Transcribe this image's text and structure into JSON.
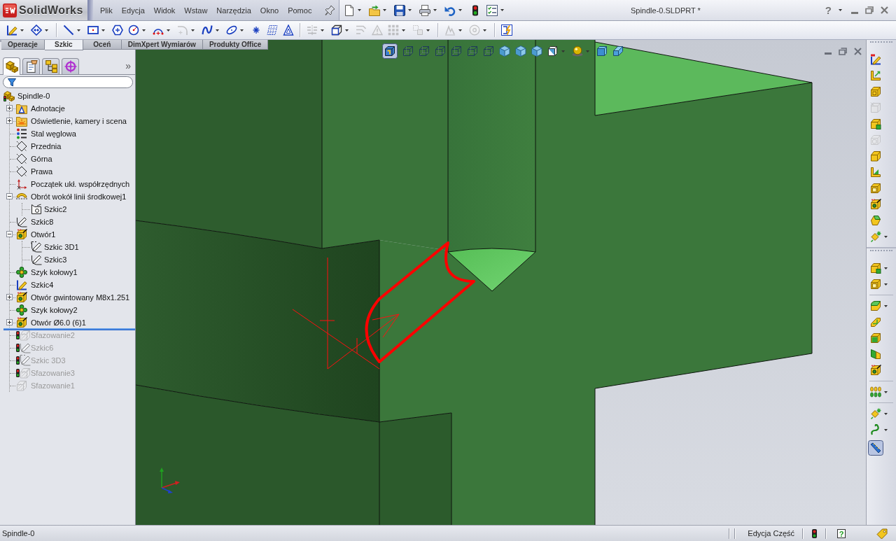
{
  "title_bar": {
    "logo": "SolidWorks",
    "menu": [
      "Plik",
      "Edycja",
      "Widok",
      "Wstaw",
      "Narzędzia",
      "Okno",
      "Pomoc"
    ],
    "quick_access": [
      {
        "kind": "new",
        "dropdown": true
      },
      {
        "kind": "open",
        "dropdown": true
      },
      {
        "kind": "save",
        "dropdown": true
      },
      {
        "kind": "print",
        "dropdown": true
      },
      {
        "kind": "undo",
        "dropdown": true
      },
      {
        "kind": "rebuild",
        "dropdown": false
      },
      {
        "kind": "options",
        "dropdown": true
      }
    ],
    "title": "Spindle-0.SLDPRT *",
    "help": "?"
  },
  "sketch_toolbar": [
    [
      {
        "kind": "sketch-tool",
        "dropdown": true,
        "disabled": false
      },
      {
        "kind": "dimension",
        "dropdown": true,
        "disabled": false
      }
    ],
    [
      {
        "kind": "line",
        "dropdown": true,
        "disabled": false
      },
      {
        "kind": "rectangle",
        "dropdown": true,
        "disabled": false
      },
      {
        "kind": "polygon",
        "dropdown": false,
        "disabled": false
      },
      {
        "kind": "circle",
        "dropdown": true,
        "disabled": false
      },
      {
        "kind": "arc",
        "dropdown": true,
        "disabled": false
      },
      {
        "kind": "sketch-fillet",
        "dropdown": true,
        "disabled": true
      },
      {
        "kind": "spline",
        "dropdown": true,
        "disabled": false
      },
      {
        "kind": "ellipse",
        "dropdown": true,
        "disabled": false
      },
      {
        "kind": "point",
        "dropdown": false,
        "disabled": false
      },
      {
        "kind": "sketch-picture",
        "dropdown": false,
        "disabled": false
      },
      {
        "kind": "text",
        "dropdown": false,
        "disabled": false
      }
    ],
    [
      {
        "kind": "mirror",
        "dropdown": true,
        "disabled": true
      },
      {
        "kind": "convert",
        "dropdown": true,
        "disabled": false
      },
      {
        "kind": "trim",
        "dropdown": false,
        "disabled": true
      },
      {
        "kind": "warning",
        "dropdown": false,
        "disabled": true
      },
      {
        "kind": "grid",
        "dropdown": true,
        "disabled": true
      },
      {
        "kind": "move",
        "dropdown": true,
        "disabled": true
      }
    ],
    [
      {
        "kind": "repair",
        "dropdown": true,
        "disabled": true
      },
      {
        "kind": "snap",
        "dropdown": true,
        "disabled": true
      }
    ],
    [
      {
        "kind": "quick-snap",
        "dropdown": false,
        "disabled": false
      }
    ]
  ],
  "command_tabs": [
    {
      "label": "Operacje",
      "selected": false
    },
    {
      "label": "Szkic",
      "selected": true
    },
    {
      "label": "Oceń",
      "selected": false
    },
    {
      "label": "DimXpert Wymiarów",
      "selected": false
    },
    {
      "label": "Produkty Office",
      "selected": false
    }
  ],
  "panel_tabs": {
    "items": [
      {
        "kind": "features",
        "selected": true
      },
      {
        "kind": "properties",
        "selected": false
      },
      {
        "kind": "configurations",
        "selected": false
      },
      {
        "kind": "dimxpert",
        "selected": false
      }
    ],
    "more": "»"
  },
  "feature_tree": {
    "label": "Spindle-0",
    "kind": "part",
    "children": [
      {
        "label": "Adnotacje",
        "kind": "annotations",
        "expanded": false,
        "rolled_back": false,
        "flagged": false
      },
      {
        "label": "Oświetlenie, kamery i scena",
        "kind": "lights",
        "expanded": false,
        "rolled_back": false,
        "flagged": false
      },
      {
        "label": "Stal węglowa",
        "kind": "material",
        "rolled_back": false,
        "flagged": false
      },
      {
        "label": "Przednia",
        "kind": "plane",
        "rolled_back": false,
        "flagged": false
      },
      {
        "label": "Górna",
        "kind": "plane",
        "rolled_back": false,
        "flagged": false
      },
      {
        "label": "Prawa",
        "kind": "plane",
        "rolled_back": false,
        "flagged": false
      },
      {
        "label": "Początek ukł. współrzędnych",
        "kind": "origin",
        "rolled_back": false,
        "flagged": false
      },
      {
        "label": "Obrót wokół linii środkowej1",
        "kind": "revolve",
        "expanded": true,
        "rolled_back": false,
        "flagged": false,
        "children": [
          {
            "label": "Szkic2",
            "kind": "sketch-plane",
            "rolled_back": false,
            "flagged": false
          }
        ]
      },
      {
        "label": "Szkic8",
        "kind": "sketch",
        "rolled_back": false,
        "flagged": false
      },
      {
        "label": "Otwór1",
        "kind": "hole",
        "expanded": true,
        "rolled_back": false,
        "flagged": false,
        "children": [
          {
            "label": "Szkic 3D1",
            "kind": "sketch3d",
            "rolled_back": false,
            "flagged": false
          },
          {
            "label": "Szkic3",
            "kind": "sketch",
            "rolled_back": false,
            "flagged": false
          }
        ]
      },
      {
        "label": "Szyk kołowy1",
        "kind": "pattern",
        "rolled_back": false,
        "flagged": false
      },
      {
        "label": "Szkic4",
        "kind": "sketch-active",
        "rolled_back": false,
        "flagged": false
      },
      {
        "label": "Otwór gwintowany M8x1.251",
        "kind": "hole",
        "expanded": false,
        "rolled_back": false,
        "flagged": false
      },
      {
        "label": "Szyk kołowy2",
        "kind": "pattern",
        "rolled_back": false,
        "flagged": false
      },
      {
        "label": "Otwór Ø6.0 (6)1",
        "kind": "hole",
        "expanded": false,
        "rolled_back": false,
        "flagged": false
      },
      {
        "label": "Sfazowanie2",
        "kind": "chamfer",
        "rolled_back": true,
        "flagged": true
      },
      {
        "label": "Szkic6",
        "kind": "sketch",
        "rolled_back": true,
        "flagged": true
      },
      {
        "label": "Szkic 3D3",
        "kind": "sketch3d",
        "rolled_back": true,
        "flagged": true
      },
      {
        "label": "Sfazowanie3",
        "kind": "chamfer",
        "rolled_back": true,
        "flagged": true
      },
      {
        "label": "Sfazowanie1",
        "kind": "chamfer",
        "rolled_back": true,
        "flagged": false
      }
    ]
  },
  "view_toolbar": [
    {
      "kind": "orientation",
      "selected": true,
      "dropdown": false
    },
    {
      "kind": "wire",
      "selected": false,
      "dropdown": false
    },
    {
      "kind": "wire",
      "selected": false,
      "dropdown": false
    },
    {
      "kind": "wire",
      "selected": false,
      "dropdown": false
    },
    {
      "kind": "wire",
      "selected": false,
      "dropdown": false
    },
    {
      "kind": "wire",
      "selected": false,
      "dropdown": false
    },
    {
      "kind": "wire",
      "selected": false,
      "dropdown": false
    },
    {
      "kind": "shaded",
      "selected": false,
      "dropdown": false
    },
    {
      "kind": "shaded",
      "selected": false,
      "dropdown": false
    },
    {
      "kind": "shaded",
      "selected": false,
      "dropdown": false
    },
    {
      "kind": "display",
      "selected": false,
      "dropdown": true
    },
    {
      "kind": "appearance",
      "selected": false,
      "dropdown": true
    },
    {
      "kind": "scene",
      "selected": false,
      "dropdown": false
    },
    {
      "kind": "prism",
      "selected": false,
      "dropdown": false
    }
  ],
  "task_toolbars": [
    {
      "groups": [
        [
          {
            "kind": "spatial-sketch",
            "dropdown": false,
            "disabled": false,
            "selected": false
          },
          {
            "kind": "ref-geometry",
            "dropdown": false,
            "disabled": false,
            "selected": false
          },
          {
            "kind": "boss",
            "dropdown": false,
            "disabled": false,
            "selected": false
          },
          {
            "kind": "cut",
            "dropdown": false,
            "disabled": true,
            "selected": false
          },
          {
            "kind": "insert",
            "dropdown": false,
            "disabled": false,
            "selected": false
          },
          {
            "kind": "shell",
            "dropdown": false,
            "disabled": true,
            "selected": false
          },
          {
            "kind": "box",
            "dropdown": false,
            "disabled": false,
            "selected": false
          },
          {
            "kind": "bracket",
            "dropdown": false,
            "disabled": false,
            "selected": false
          },
          {
            "kind": "wrap",
            "dropdown": false,
            "disabled": false,
            "selected": false
          },
          {
            "kind": "hole",
            "dropdown": false,
            "disabled": false,
            "selected": false
          },
          {
            "kind": "chamfer-feature",
            "dropdown": false,
            "disabled": false,
            "selected": false
          },
          {
            "kind": "sparkle",
            "dropdown": true,
            "disabled": false,
            "selected": false
          }
        ]
      ]
    },
    {
      "groups": [
        [
          {
            "kind": "insert",
            "dropdown": true,
            "disabled": false,
            "selected": false
          },
          {
            "kind": "wrap",
            "dropdown": true,
            "disabled": false,
            "selected": false
          }
        ],
        [
          {
            "kind": "fillet-feature",
            "dropdown": true,
            "disabled": false,
            "selected": false
          },
          {
            "kind": "rib",
            "dropdown": false,
            "disabled": false,
            "selected": false
          },
          {
            "kind": "face",
            "dropdown": false,
            "disabled": false,
            "selected": false
          },
          {
            "kind": "wedge",
            "dropdown": false,
            "disabled": false,
            "selected": false
          },
          {
            "kind": "hole",
            "dropdown": false,
            "disabled": false,
            "selected": false
          }
        ],
        [
          {
            "kind": "pattern-feature",
            "dropdown": true,
            "disabled": false,
            "selected": false
          }
        ],
        [
          {
            "kind": "sparkle",
            "dropdown": true,
            "disabled": false,
            "selected": false
          },
          {
            "kind": "curve",
            "dropdown": true,
            "disabled": false,
            "selected": false
          },
          {
            "kind": "ruler",
            "dropdown": false,
            "disabled": false,
            "selected": true
          }
        ]
      ]
    }
  ],
  "status_bar": {
    "document": "Spindle-0",
    "mode": "Edycja Część",
    "help": "?"
  }
}
